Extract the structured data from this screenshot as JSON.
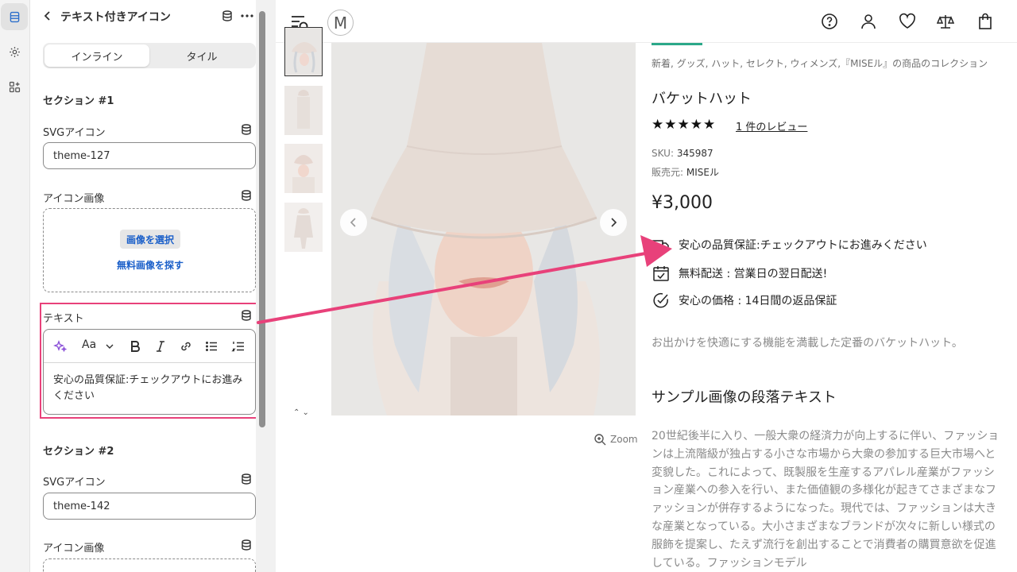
{
  "panel": {
    "title": "テキスト付きアイコン",
    "tabs": [
      "インライン",
      "タイル"
    ],
    "section1": {
      "title": "セクション #1",
      "svg_label": "SVGアイコン",
      "svg_value": "theme-127",
      "image_label": "アイコン画像",
      "select_image": "画像を選択",
      "find_free_image": "無料画像を探す",
      "text_label": "テキスト",
      "text_toolbar_font": "Aa",
      "text_value": "安心の品質保証:チェックアウトにお進みください"
    },
    "section2": {
      "title": "セクション #2",
      "svg_label": "SVGアイコン",
      "svg_value": "theme-142",
      "image_label": "アイコン画像"
    }
  },
  "store": {
    "logo_letter": "M",
    "zoom_label": "Zoom",
    "product": {
      "collection": "新着, グッズ, ハット, セレクト, ウィメンズ,『MISEル』の商品のコレクション",
      "title": "バケットハット",
      "stars": "★★★★★",
      "reviews": "1 件のレビュー",
      "sku_label": "SKU:",
      "sku_value": "345987",
      "vendor_label": "販売元:",
      "vendor_value": "MISEル",
      "price": "¥3,000",
      "features": [
        "安心の品質保証:チェックアウトにお進みください",
        "無料配送 : 営業日の翌日配送!",
        "安心の価格 : 14日間の返品保証"
      ],
      "description": "お出かけを快適にする機能を満載した定番のバケットハット。",
      "paragraph_title": "サンプル画像の段落テキスト",
      "paragraph": "20世紀後半に入り、一般大衆の経済力が向上するに伴い、ファッションは上流階級が独占する小さな市場から大衆の参加する巨大市場へと変貌した。これによって、既製服を生産するアパレル産業がファッション産業への参入を行い、また価値観の多様化が起きてさまざまなファッションが併存するようになった。現代では、ファッションは大きな産業となっている。大小さまざまなブランドが次々に新しい様式の服飾を提案し、たえず流行を創出することで消費者の購買意欲を促進している。ファッションモデル"
    }
  },
  "colors": {
    "highlight": "#e8417a",
    "accent": "#2ba889",
    "link": "#1a5fc9"
  }
}
